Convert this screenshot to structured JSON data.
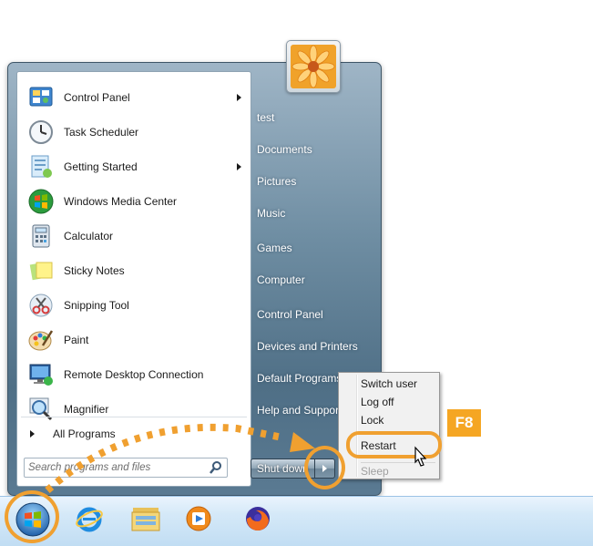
{
  "start_menu": {
    "programs": [
      {
        "label": "Control Panel",
        "icon": "control-panel-icon",
        "has_submenu": true
      },
      {
        "label": "Task Scheduler",
        "icon": "task-scheduler-icon",
        "has_submenu": false
      },
      {
        "label": "Getting Started",
        "icon": "getting-started-icon",
        "has_submenu": true
      },
      {
        "label": "Windows Media Center",
        "icon": "media-center-icon",
        "has_submenu": false
      },
      {
        "label": "Calculator",
        "icon": "calculator-icon",
        "has_submenu": false
      },
      {
        "label": "Sticky Notes",
        "icon": "sticky-notes-icon",
        "has_submenu": false
      },
      {
        "label": "Snipping Tool",
        "icon": "snipping-tool-icon",
        "has_submenu": false
      },
      {
        "label": "Paint",
        "icon": "paint-icon",
        "has_submenu": false
      },
      {
        "label": "Remote Desktop Connection",
        "icon": "remote-desktop-icon",
        "has_submenu": false
      },
      {
        "label": "Magnifier",
        "icon": "magnifier-icon",
        "has_submenu": false
      }
    ],
    "all_programs_label": "All Programs",
    "search_placeholder": "Search programs and files",
    "right_items": [
      "test",
      "Documents",
      "Pictures",
      "Music",
      "Games",
      "Computer",
      "Control Panel",
      "Devices and Printers",
      "Default Programs",
      "Help and Support"
    ],
    "shutdown_label": "Shut down"
  },
  "flyout": {
    "items": [
      "Switch user",
      "Log off",
      "Lock",
      "Restart",
      "Sleep"
    ],
    "highlighted": "Restart",
    "disabled": "Sleep"
  },
  "annotation": {
    "key_badge": "F8",
    "color": "#f0a030"
  },
  "taskbar": {
    "icons": [
      "start-orb-icon",
      "internet-explorer-icon",
      "file-explorer-icon",
      "media-player-icon",
      "firefox-icon"
    ]
  }
}
